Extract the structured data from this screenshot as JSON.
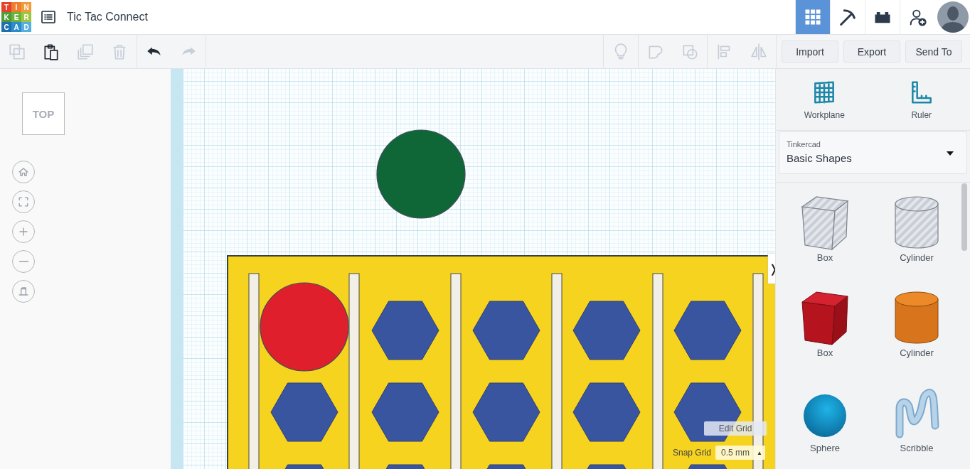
{
  "logo": {
    "tiles": [
      {
        "letter": "T",
        "color": "#e5412d"
      },
      {
        "letter": "I",
        "color": "#ee7d2f"
      },
      {
        "letter": "N",
        "color": "#f29b38"
      },
      {
        "letter": "K",
        "color": "#4e9c38"
      },
      {
        "letter": "E",
        "color": "#6cb23b"
      },
      {
        "letter": "R",
        "color": "#9dc53d"
      },
      {
        "letter": "C",
        "color": "#1d6fad"
      },
      {
        "letter": "A",
        "color": "#2b8ccc"
      },
      {
        "letter": "D",
        "color": "#55aede"
      }
    ]
  },
  "title": "Tic Tac Connect",
  "nav_buttons": [
    {
      "kind": "grid",
      "selected": true
    },
    {
      "kind": "pickaxe",
      "selected": false
    },
    {
      "kind": "bricks",
      "selected": false
    },
    {
      "kind": "add-user",
      "selected": false
    }
  ],
  "toolbar": {
    "edit_tools": [
      {
        "kind": "copy",
        "disabled": true
      },
      {
        "kind": "paste",
        "disabled": false
      },
      {
        "kind": "duplicate",
        "disabled": true
      },
      {
        "kind": "delete",
        "disabled": true
      },
      {
        "kind": "undo",
        "disabled": false
      },
      {
        "kind": "redo",
        "disabled": true
      }
    ],
    "shape_tools": [
      {
        "kind": "note",
        "disabled": true
      },
      {
        "kind": "group",
        "disabled": true
      },
      {
        "kind": "ungroup",
        "disabled": true
      },
      {
        "kind": "align",
        "disabled": true
      },
      {
        "kind": "mirror",
        "disabled": true
      }
    ],
    "buttons": [
      "Import",
      "Export",
      "Send To"
    ]
  },
  "view_cube": "TOP",
  "view_controls": [
    {
      "kind": "home"
    },
    {
      "kind": "fit"
    },
    {
      "kind": "zoom-in"
    },
    {
      "kind": "zoom-out"
    },
    {
      "kind": "ortho"
    }
  ],
  "canvas": {
    "collapse": "❭",
    "edit_grid": "Edit Grid",
    "snap_label": "Snap Grid",
    "snap_value": "0.5 mm",
    "stepper": "▲"
  },
  "panel": {
    "tools": [
      {
        "kind": "workplane",
        "label": "Workplane"
      },
      {
        "kind": "ruler",
        "label": "Ruler"
      }
    ],
    "library": {
      "source": "Tinkercad",
      "name": "Basic Shapes"
    },
    "shapes": [
      {
        "kind": "box-hole",
        "label": "Box"
      },
      {
        "kind": "cylinder-hole",
        "label": "Cylinder"
      },
      {
        "kind": "box",
        "label": "Box"
      },
      {
        "kind": "cylinder",
        "label": "Cylinder"
      },
      {
        "kind": "sphere",
        "label": "Sphere"
      },
      {
        "kind": "scribble",
        "label": "Scribble"
      }
    ]
  }
}
